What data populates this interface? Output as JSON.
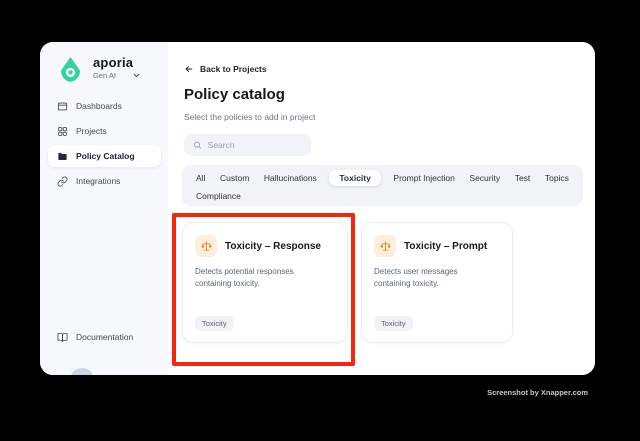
{
  "sidebar": {
    "brand": "aporia",
    "workspace": "Gen AI",
    "items": [
      {
        "label": "Dashboards",
        "icon": "dashboards-icon",
        "active": false
      },
      {
        "label": "Projects",
        "icon": "projects-icon",
        "active": false
      },
      {
        "label": "Policy Catalog",
        "icon": "folder-icon",
        "active": true
      },
      {
        "label": "Integrations",
        "icon": "link-icon",
        "active": false
      }
    ],
    "documentation_label": "Documentation"
  },
  "main": {
    "back_link": "Back to Projects",
    "title": "Policy catalog",
    "subtitle": "Select the policies to add in project",
    "search_placeholder": "Search",
    "tabs": [
      "All",
      "Custom",
      "Hallucinations",
      "Toxicity",
      "Prompt Injection",
      "Security",
      "Test",
      "Topics",
      "Compliance"
    ],
    "active_tab": "Toxicity",
    "cards": [
      {
        "title": "Toxicity – Response",
        "description": "Detects potential responses containing toxicity.",
        "tag": "Toxicity"
      },
      {
        "title": "Toxicity – Prompt",
        "description": "Detects user messages containing toxicity.",
        "tag": "Toxicity"
      }
    ]
  },
  "watermark": "Screenshot by Xnapper.com",
  "colors": {
    "brand_teal": "#35d3a2",
    "highlight_red": "#f4270c",
    "policy_icon_orange": "#f58220",
    "policy_icon_bg": "#fdeedd",
    "sidebar_bg": "#f7f8fb",
    "pill_bg": "#f2f3f8"
  }
}
